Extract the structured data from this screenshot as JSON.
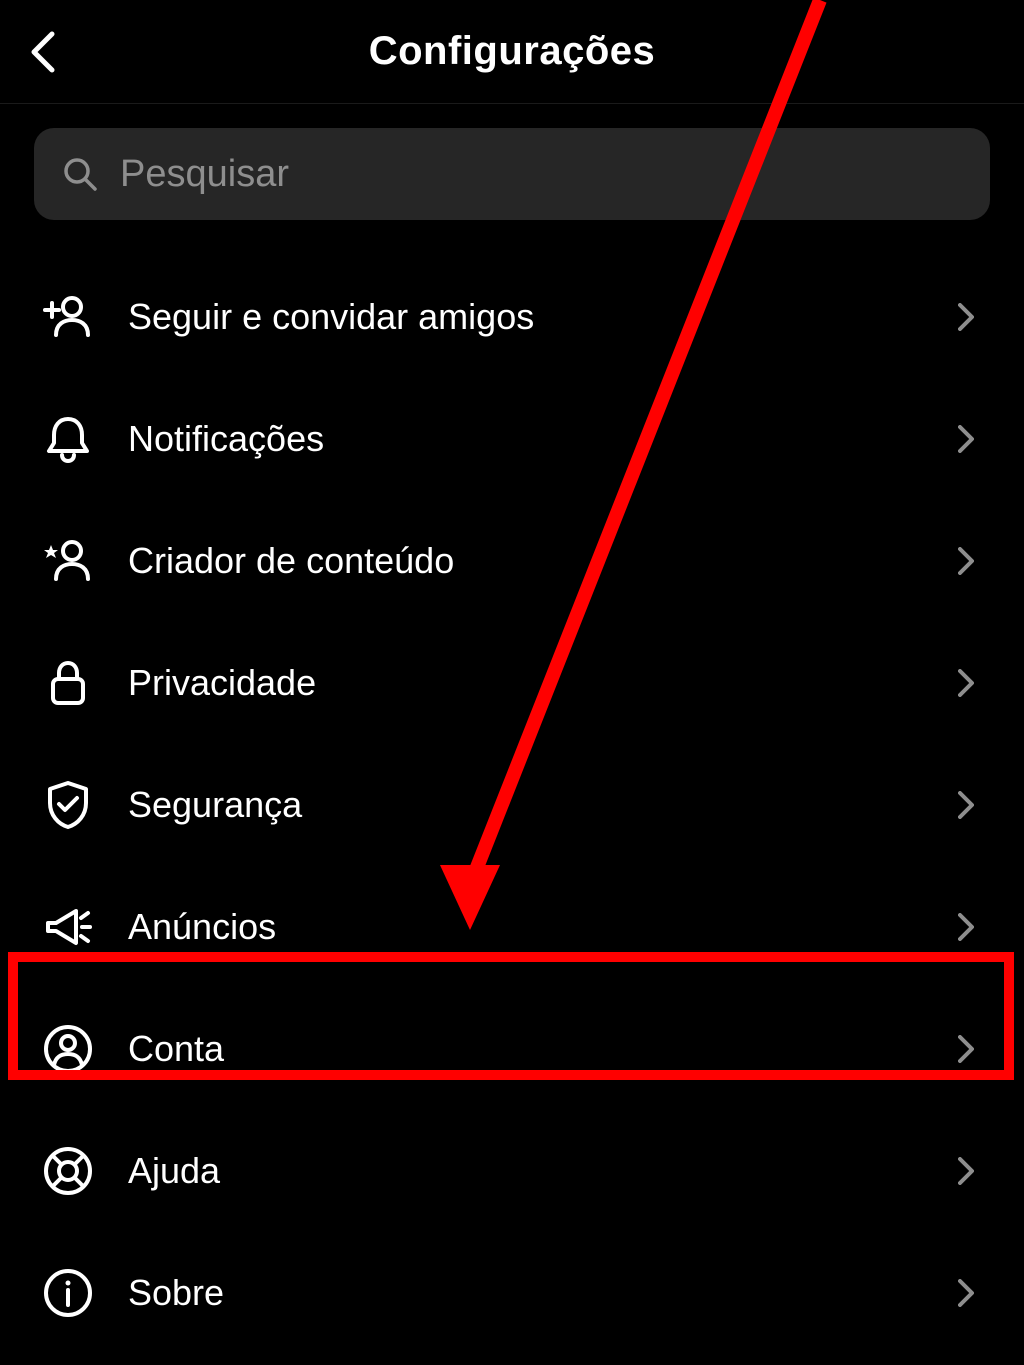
{
  "header": {
    "title": "Configurações"
  },
  "search": {
    "placeholder": "Pesquisar"
  },
  "menu": {
    "items": [
      {
        "label": "Seguir e convidar amigos"
      },
      {
        "label": "Notificações"
      },
      {
        "label": "Criador de conteúdo"
      },
      {
        "label": "Privacidade"
      },
      {
        "label": "Segurança"
      },
      {
        "label": "Anúncios"
      },
      {
        "label": "Conta"
      },
      {
        "label": "Ajuda"
      },
      {
        "label": "Sobre"
      }
    ]
  },
  "annotation": {
    "highlight_color": "#ff0000",
    "highlighted_item": "Conta"
  }
}
